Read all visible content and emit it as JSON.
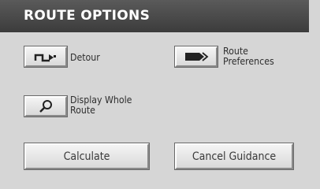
{
  "title": "ROUTE OPTIONS",
  "options": {
    "detour": {
      "label": "Detour",
      "icon": "detour-arrow-icon"
    },
    "route_preferences": {
      "label_line1": "Route",
      "label_line2": "Preferences",
      "icon": "route-tag-icon"
    },
    "display_whole_route": {
      "label_line1": "Display Whole",
      "label_line2": "Route",
      "icon": "magnifier-icon"
    }
  },
  "actions": {
    "calculate": "Calculate",
    "cancel_guidance": "Cancel Guidance"
  }
}
